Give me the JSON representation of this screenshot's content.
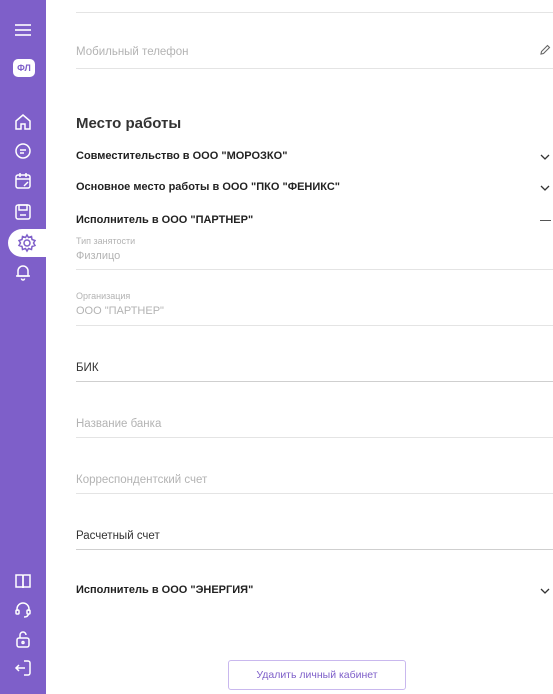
{
  "sidebar": {
    "badge": "ФЛ",
    "icons": [
      "menu-icon",
      "home-icon",
      "document-icon",
      "calendar-edit-icon",
      "floppy-icon",
      "gear-icon",
      "bell-icon",
      "book-icon",
      "support-icon",
      "unlock-icon",
      "logout-icon"
    ],
    "accent": "#7e5fc9"
  },
  "personal": {
    "phone_label": "Мобильный телефон"
  },
  "workplace": {
    "title": "Место работы",
    "items": [
      {
        "title": "Совместительство в ООО \"МОРОЗКО\"",
        "state": "collapsed"
      },
      {
        "title": "Основное место работы в ООО \"ПКО \"ФЕНИКС\"",
        "state": "collapsed"
      },
      {
        "title": "Исполнитель в ООО \"ПАРТНЕР\"",
        "state": "expanded"
      }
    ],
    "expanded": {
      "employment_type_label": "Тип занятости",
      "employment_type_value": "Физлицо",
      "organization_label": "Организация",
      "organization_value": "ООО \"ПАРТНЕР\"",
      "bik_label": "БИК",
      "bank_name_label": "Название банка",
      "corr_account_label": "Корреспондентский счет",
      "settlement_account_label": "Расчетный счет"
    },
    "last_item": {
      "title": "Исполнитель в ООО \"ЭНЕРГИЯ\"",
      "state": "collapsed"
    }
  },
  "actions": {
    "delete_label": "Удалить личный кабинет"
  }
}
